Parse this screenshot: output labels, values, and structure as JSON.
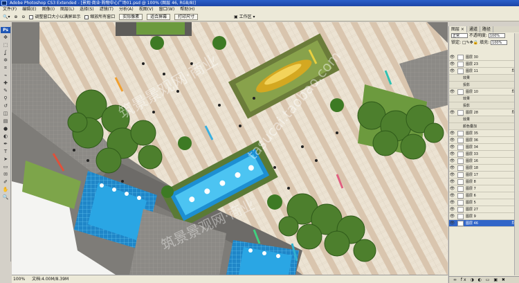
{
  "window": {
    "title": "Adobe Photoshop CS3 Extended - [景观·商业·购物中心广场01.psd @ 100% (图层 46, RGB/8)]"
  },
  "menu": [
    "文件(F)",
    "编辑(E)",
    "图像(I)",
    "图层(L)",
    "选择(S)",
    "滤镜(T)",
    "分析(A)",
    "视图(V)",
    "窗口(W)",
    "帮助(H)"
  ],
  "options": {
    "resize_windows_label": "调整窗口大小以满屏显示",
    "zoom_all_label": "缩放所有窗口",
    "actual_pixels_label": "实际像素",
    "fit_screen_label": "适合屏幕",
    "print_size_label": "打印尺寸",
    "workspace_label": "工作区 ▾"
  },
  "toolbox": {
    "logo": "Ps",
    "tools": [
      "move-icon",
      "marquee-icon",
      "lasso-icon",
      "magic-wand-icon",
      "crop-icon",
      "slice-icon",
      "healing-icon",
      "brush-icon",
      "stamp-icon",
      "history-brush-icon",
      "eraser-icon",
      "gradient-icon",
      "blur-icon",
      "dodge-icon",
      "pen-icon",
      "type-icon",
      "path-select-icon",
      "shape-icon",
      "notes-icon",
      "eyedropper-icon",
      "hand-icon",
      "zoom-icon"
    ],
    "glyphs": [
      "✥",
      "⬚",
      "ʆ",
      "✲",
      "⌗",
      "⌁",
      "✚",
      "✎",
      "⚲",
      "↺",
      "◫",
      "▤",
      "●",
      "◐",
      "✒",
      "T",
      "➤",
      "▭",
      "✉",
      "✐",
      "✋",
      "🔍"
    ]
  },
  "layers_panel": {
    "tabs": [
      "图层 ×",
      "通道",
      "路径"
    ],
    "blend_mode": "正常",
    "opacity_label": "不透明度:",
    "opacity_value": "100%",
    "lock_label": "锁定:",
    "fill_label": "填充:",
    "fill_value": "100%",
    "layers": [
      {
        "name": "图层 30",
        "type": "layer",
        "fx": false
      },
      {
        "name": "图层 23",
        "type": "layer",
        "fx": false
      },
      {
        "name": "图层 11",
        "type": "layer",
        "fx": true
      },
      {
        "name": "效果",
        "type": "effect",
        "fx": false
      },
      {
        "name": "投影",
        "type": "effect",
        "fx": false
      },
      {
        "name": "图层 10",
        "type": "layer",
        "fx": true
      },
      {
        "name": "效果",
        "type": "effect",
        "fx": false
      },
      {
        "name": "投影",
        "type": "effect",
        "fx": false
      },
      {
        "name": "图层 28",
        "type": "layer",
        "fx": true
      },
      {
        "name": "效果",
        "type": "effect",
        "fx": false
      },
      {
        "name": "颜色叠加",
        "type": "effect",
        "fx": false
      },
      {
        "name": "图层 35",
        "type": "layer",
        "fx": false
      },
      {
        "name": "图层 36",
        "type": "layer",
        "fx": false
      },
      {
        "name": "图层 34",
        "type": "layer",
        "fx": false
      },
      {
        "name": "图层 33",
        "type": "layer",
        "fx": false
      },
      {
        "name": "图层 16",
        "type": "layer",
        "fx": false
      },
      {
        "name": "图层 18",
        "type": "layer",
        "fx": false
      },
      {
        "name": "图层 17",
        "type": "layer",
        "fx": false
      },
      {
        "name": "图层 8",
        "type": "layer",
        "fx": false
      },
      {
        "name": "图层 7",
        "type": "layer",
        "fx": false
      },
      {
        "name": "图层 6",
        "type": "layer",
        "fx": false
      },
      {
        "name": "图层 5",
        "type": "layer",
        "fx": false
      },
      {
        "name": "图层 27",
        "type": "layer",
        "fx": false
      },
      {
        "name": "图层 9",
        "type": "layer",
        "fx": false
      },
      {
        "name": "图层 46",
        "type": "layer",
        "fx": true,
        "active": true
      }
    ],
    "bottom_icons": "∞ fx ◑ ◐ ▭ ▣ ✖"
  },
  "status": {
    "zoom": "100%",
    "doc": "文档:4.00M/8.39M"
  },
  "watermarks": [
    "筑景景观网·商业",
    "tasucai.taobao.com"
  ],
  "colors": {
    "paving": "#e9dfcf",
    "stripe": "#d7c3ae",
    "dark_band": "#6d6b68",
    "water": "#2fa9e6",
    "grass": "#7da54a",
    "tree": "#4d7f2d"
  }
}
